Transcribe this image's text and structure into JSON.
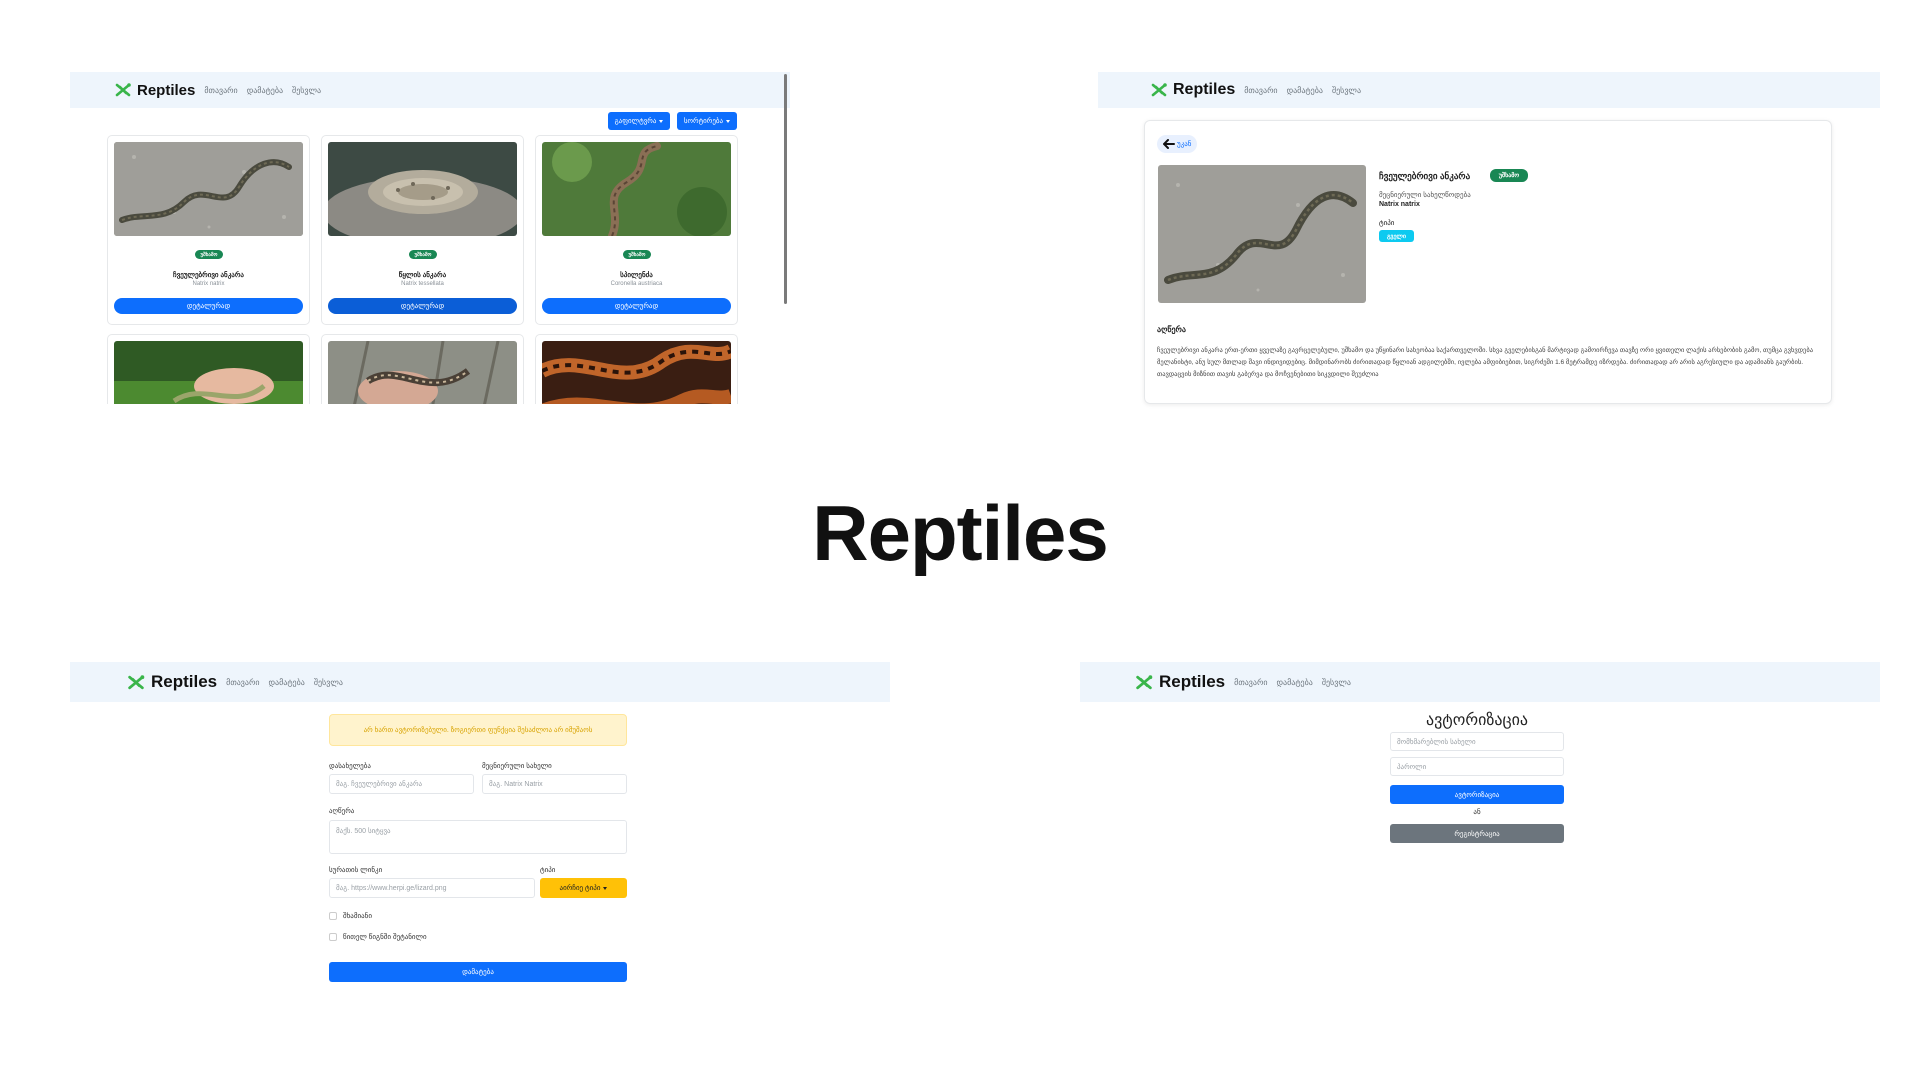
{
  "center_title": "Reptiles",
  "colors": {
    "primary": "#0d6efd",
    "success": "#198754",
    "warning": "#ffc107",
    "info": "#0dcaf0",
    "secondary": "#6c757d",
    "navbar_bg": "#eef5fc"
  },
  "icons": {
    "brand": "gecko-icon",
    "back": "arrow-left-icon",
    "dropdown": "caret-down-icon"
  },
  "navbar": {
    "brand": "Reptiles",
    "links": [
      "მთავარი",
      "დამატება",
      "შესვლა"
    ]
  },
  "list_view": {
    "filter_label": "გაფილტვრა",
    "sort_label": "სორტირება",
    "cards": [
      {
        "badge": "უშხამო",
        "name": "ჩვეულებრივი ანკარა",
        "scientific": "Natrix natrix",
        "button": "დეტალურად"
      },
      {
        "badge": "უშხამო",
        "name": "წყლის ანკარა",
        "scientific": "Natrix tessellata",
        "button": "დეტალურად"
      },
      {
        "badge": "უშხამო",
        "name": "სპილენძა",
        "scientific": "Coronella austriaca",
        "button": "დეტალურად"
      }
    ]
  },
  "detail_view": {
    "back_label": "უკან",
    "name": "ჩვეულებრივი ანკარა",
    "badge": "უშხამო",
    "scientific_label": "მეცნიერული სახელწოდება",
    "scientific_name": "Natrix natrix",
    "type_label": "ტიპი",
    "type_value": "გველი",
    "description_heading": "აღწერა",
    "description": "ჩვეულებრივი ანკარა ერთ-ერთი ყველაზე გავრცელებული, უშხამო და უწყინარი სახეობაა საქართველოში. სხვა გველებისგან მარტივად გამოირჩევა თავზე ორი ყვითელი ლაქის არსებობის გამო, თუმცა გვხვდება მელანისტი, ანუ სულ მთლად შავი ინდივიდებიც. მიმდინარობს ძირითადად წყლიან ადგილებში, ივლება ამფიბიებით, სიგრძეში 1.6 მეტრამდე იზრდება. ძირითადად არ არის აგრესიული და ადამიანს გაურბის. თავდაცვის მიზნით თავის გაბერვა და მოჩვენებითი სიკვდილი შეუძლია"
  },
  "add_view": {
    "warning": "არ ხართ ავტორიზებული. ზოგიერთი ფუნქცია შესაძლოა არ იმუშაოს",
    "name_label": "დასახელება",
    "name_placeholder": "მაგ. ჩვეულებრივი ანკარა",
    "sci_label": "მეცნიერული სახელი",
    "sci_placeholder": "მაგ. Natrix Natrix",
    "desc_label": "აღწერა",
    "desc_placeholder": "მაქს. 500 სიტყვა",
    "image_label": "სურათის ლინკი",
    "image_placeholder": "მაგ. https://www.herpi.ge/lizard.png",
    "type_label": "ტიპი",
    "type_button": "აირჩიე ტიპი",
    "venomous_label": "შხამიანი",
    "redbook_label": "წითელ წიგნში შეტანილი",
    "submit": "დამატება"
  },
  "auth_view": {
    "title": "ავტორიზაცია",
    "username_placeholder": "მომხმარებლის სახელი",
    "password_placeholder": "პაროლი",
    "login_button": "ავტორიზაცია",
    "or_text": "ან",
    "register_button": "რეგისტრაცია"
  }
}
